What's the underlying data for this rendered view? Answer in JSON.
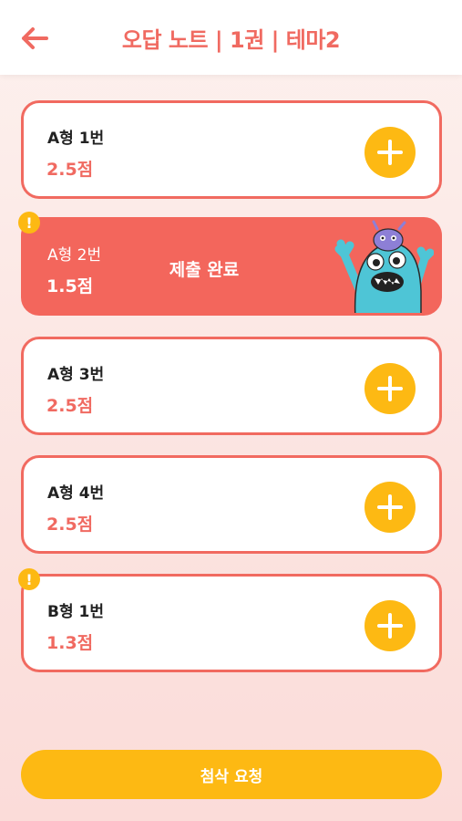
{
  "header": {
    "title": "오답 노트 | 1권 | 테마2",
    "back_icon": "arrow-left-icon"
  },
  "colors": {
    "accent": "#f06a61",
    "yellow": "#fdb913",
    "white": "#ffffff"
  },
  "items": [
    {
      "name": "A형 1번",
      "score": "2.5점",
      "status": "add"
    },
    {
      "name": "A형 2번",
      "score": "1.5점",
      "status": "done",
      "status_label": "제출 완료",
      "alert": true
    },
    {
      "name": "A형 3번",
      "score": "2.5점",
      "status": "add"
    },
    {
      "name": "A형 4번",
      "score": "2.5점",
      "status": "add"
    },
    {
      "name": "B형 1번",
      "score": "1.3점",
      "status": "add",
      "alert": true
    }
  ],
  "alert_symbol": "!",
  "submit_label": "첨삭 요청"
}
